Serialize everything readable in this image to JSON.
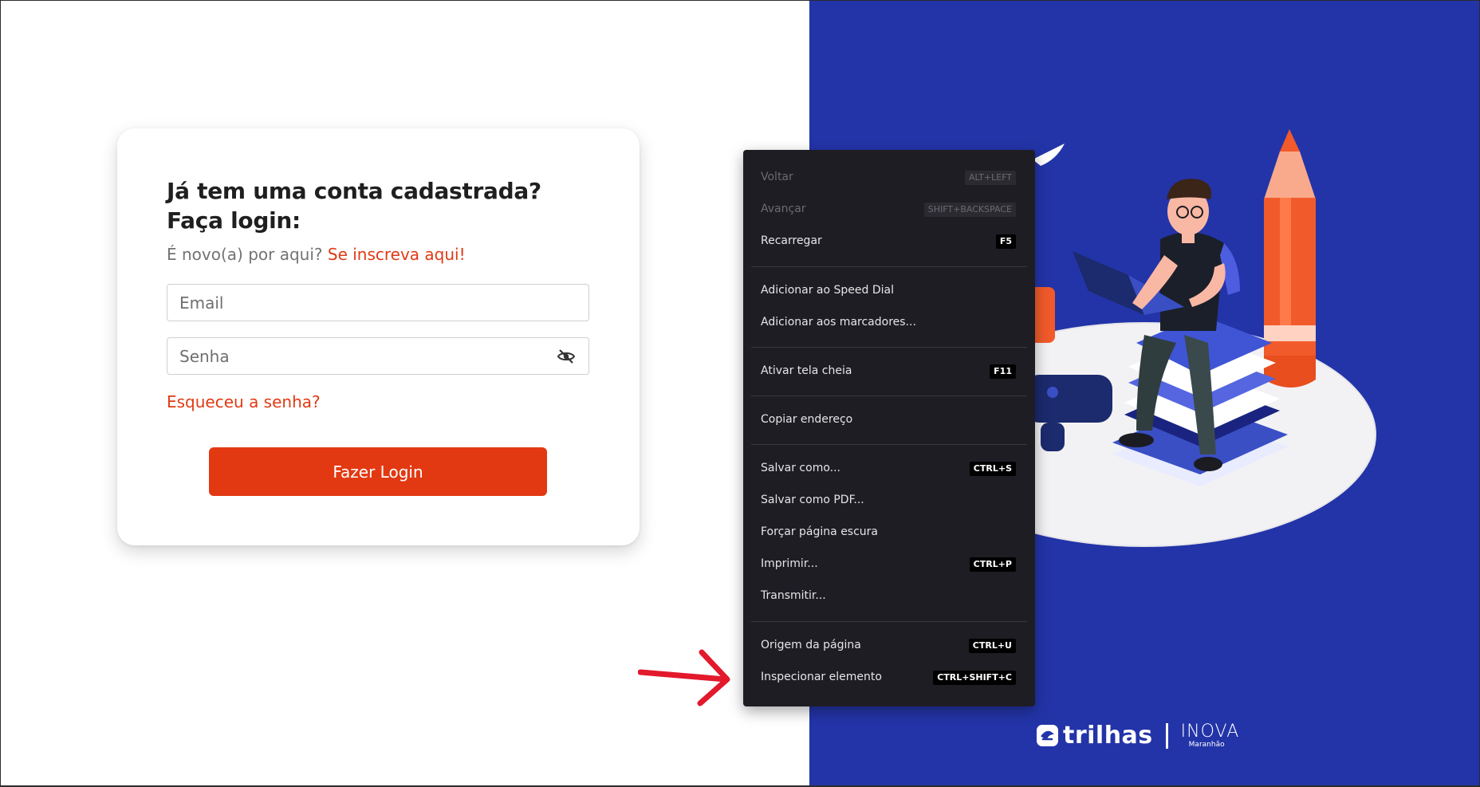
{
  "login": {
    "title": "Já tem uma conta cadastrada? Faça login:",
    "subtitle_static": "É novo(a) por aqui?",
    "signup_link": "Se inscreva aqui!",
    "email_placeholder": "Email",
    "password_placeholder": "Senha",
    "password_toggle_icon": "eye-slash-icon",
    "forgot_link": "Esqueceu a senha?",
    "submit_label": "Fazer Login",
    "accent_color": "#e23913"
  },
  "context_menu": {
    "items": [
      {
        "label": "Voltar",
        "shortcut": "ALT+LEFT",
        "disabled": true
      },
      {
        "label": "Avançar",
        "shortcut": "SHIFT+BACKSPACE",
        "disabled": true
      },
      {
        "label": "Recarregar",
        "shortcut": "F5",
        "disabled": false
      },
      {
        "label": "Adicionar ao Speed Dial",
        "shortcut": "",
        "disabled": false
      },
      {
        "label": "Adicionar aos marcadores...",
        "shortcut": "",
        "disabled": false
      },
      {
        "label": "Ativar tela cheia",
        "shortcut": "F11",
        "disabled": false
      },
      {
        "label": "Copiar endereço",
        "shortcut": "",
        "disabled": false
      },
      {
        "label": "Salvar como...",
        "shortcut": "CTRL+S",
        "disabled": false
      },
      {
        "label": "Salvar como PDF...",
        "shortcut": "",
        "disabled": false
      },
      {
        "label": "Forçar página escura",
        "shortcut": "",
        "disabled": false
      },
      {
        "label": "Imprimir...",
        "shortcut": "CTRL+P",
        "disabled": false
      },
      {
        "label": "Transmitir...",
        "shortcut": "",
        "disabled": false
      },
      {
        "label": "Origem da página",
        "shortcut": "CTRL+U",
        "disabled": false
      },
      {
        "label": "Inspecionar elemento",
        "shortcut": "CTRL+SHIFT+C",
        "disabled": false
      }
    ]
  },
  "branding": {
    "trilhas": "trilhas",
    "inova": "INOVA",
    "inova_sub": "Maranhão",
    "panel_color": "#2334a8"
  },
  "annotation": {
    "arrow_color": "#e3192c",
    "arrow_icon": "red-arrow-right-icon"
  }
}
